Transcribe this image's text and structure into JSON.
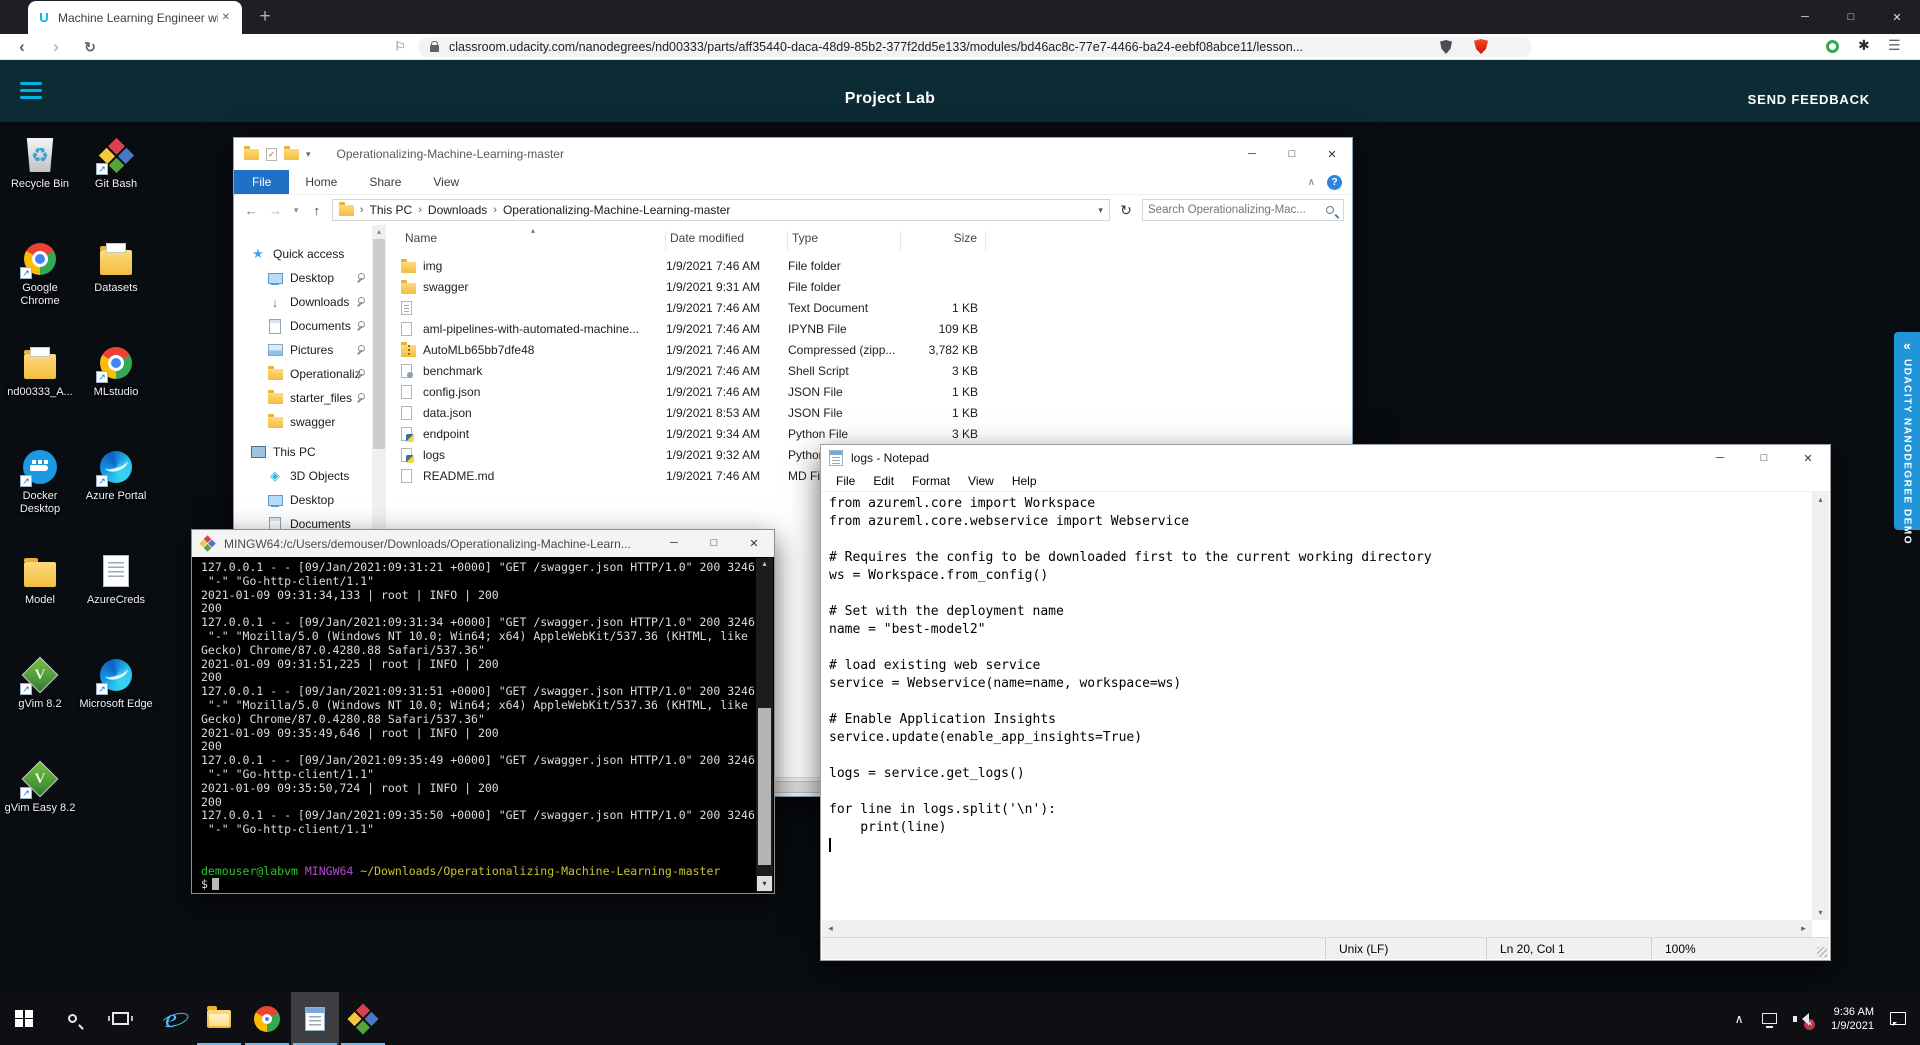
{
  "colors": {
    "accent_teal": "#02b3e3",
    "header_bg": "#0d2b35",
    "side_tab_blue": "#2095d8",
    "file_tab_blue": "#2071c5",
    "taskbar_underline": "#76b9ed"
  },
  "icons": {
    "udacity_u": "U",
    "plus": "+",
    "minimize": "─",
    "maximize": "□",
    "close": "✕",
    "back": "‹",
    "forward": "›",
    "reload": "↻",
    "bookmark_flag": "⚐",
    "menu": "☰",
    "asterisk": "✱",
    "caret_down": "▾",
    "caret_up": "▴",
    "chevron_right": "›",
    "chevron_up": "∧",
    "arrow_left": "←",
    "arrow_right": "→",
    "arrow_up": "↑",
    "question": "?",
    "check": "✓",
    "recycle": "♻",
    "star": "★",
    "download": "↓",
    "cube": "◈",
    "vim_v": "V",
    "ie_e": "e",
    "scroll_left": "◂",
    "scroll_right": "▸",
    "double_chevron_left": "«",
    "tray_up": "∧"
  },
  "browser": {
    "tab_title": "Machine Learning Engineer with",
    "url": "classroom.udacity.com/nanodegrees/nd00333/parts/aff35440-daca-48d9-85b2-377f2dd5e133/modules/bd46ac8c-77e7-4466-ba24-eebf08abce11/lesson..."
  },
  "header": {
    "title": "Project Lab",
    "feedback": "SEND FEEDBACK"
  },
  "side_tab": {
    "label": "UDACITY NANODEGREE DEMO"
  },
  "desktop": {
    "icons": [
      {
        "label": "Recycle Bin"
      },
      {
        "label": "Git Bash"
      },
      {
        "label": "Google Chrome"
      },
      {
        "label": "Datasets"
      },
      {
        "label": "nd00333_A..."
      },
      {
        "label": "MLstudio"
      },
      {
        "label": "Docker Desktop"
      },
      {
        "label": "Azure Portal"
      },
      {
        "label": "Model"
      },
      {
        "label": "AzureCreds"
      },
      {
        "label": "gVim 8.2"
      },
      {
        "label": "Microsoft Edge"
      },
      {
        "label": "gVim Easy 8.2"
      }
    ]
  },
  "explorer": {
    "title": "Operationalizing-Machine-Learning-master",
    "tabs": {
      "file": "File",
      "home": "Home",
      "share": "Share",
      "view": "View"
    },
    "breadcrumb": [
      "This PC",
      "Downloads",
      "Operationalizing-Machine-Learning-master"
    ],
    "search_placeholder": "Search Operationalizing-Mac...",
    "columns": {
      "name": "Name",
      "date": "Date modified",
      "type": "Type",
      "size": "Size"
    },
    "sidebar": [
      {
        "label": "Quick access"
      },
      {
        "label": "Desktop"
      },
      {
        "label": "Downloads"
      },
      {
        "label": "Documents"
      },
      {
        "label": "Pictures"
      },
      {
        "label": "Operationaliz"
      },
      {
        "label": "starter_files"
      },
      {
        "label": "swagger"
      },
      {
        "label": "This PC"
      },
      {
        "label": "3D Objects"
      },
      {
        "label": "Desktop"
      },
      {
        "label": "Documents"
      }
    ],
    "files": [
      {
        "name": "img",
        "date": "1/9/2021 7:46 AM",
        "type": "File folder",
        "size": ""
      },
      {
        "name": "swagger",
        "date": "1/9/2021 9:31 AM",
        "type": "File folder",
        "size": ""
      },
      {
        "name": "",
        "date": "1/9/2021 7:46 AM",
        "type": "Text Document",
        "size": "1 KB"
      },
      {
        "name": "aml-pipelines-with-automated-machine...",
        "date": "1/9/2021 7:46 AM",
        "type": "IPYNB File",
        "size": "109 KB"
      },
      {
        "name": "AutoMLb65bb7dfe48",
        "date": "1/9/2021 7:46 AM",
        "type": "Compressed (zipp...",
        "size": "3,782 KB"
      },
      {
        "name": "benchmark",
        "date": "1/9/2021 7:46 AM",
        "type": "Shell Script",
        "size": "3 KB"
      },
      {
        "name": "config.json",
        "date": "1/9/2021 7:46 AM",
        "type": "JSON File",
        "size": "1 KB"
      },
      {
        "name": "data.json",
        "date": "1/9/2021 8:53 AM",
        "type": "JSON File",
        "size": "1 KB"
      },
      {
        "name": "endpoint",
        "date": "1/9/2021 9:34 AM",
        "type": "Python File",
        "size": "3 KB"
      },
      {
        "name": "logs",
        "date": "1/9/2021 9:32 AM",
        "type": "Python File",
        "size": ""
      },
      {
        "name": "README.md",
        "date": "1/9/2021 7:46 AM",
        "type": "MD File",
        "size": ""
      }
    ]
  },
  "terminal": {
    "title": "MINGW64:/c/Users/demouser/Downloads/Operationalizing-Machine-Learn...",
    "lines": [
      "127.0.0.1 - - [09/Jan/2021:09:31:21 +0000] \"GET /swagger.json HTTP/1.0\" 200 3246",
      " \"-\" \"Go-http-client/1.1\"",
      "2021-01-09 09:31:34,133 | root | INFO | 200",
      "200",
      "127.0.0.1 - - [09/Jan/2021:09:31:34 +0000] \"GET /swagger.json HTTP/1.0\" 200 3246",
      " \"-\" \"Mozilla/5.0 (Windows NT 10.0; Win64; x64) AppleWebKit/537.36 (KHTML, like",
      "Gecko) Chrome/87.0.4280.88 Safari/537.36\"",
      "2021-01-09 09:31:51,225 | root | INFO | 200",
      "200",
      "127.0.0.1 - - [09/Jan/2021:09:31:51 +0000] \"GET /swagger.json HTTP/1.0\" 200 3246",
      " \"-\" \"Mozilla/5.0 (Windows NT 10.0; Win64; x64) AppleWebKit/537.36 (KHTML, like",
      "Gecko) Chrome/87.0.4280.88 Safari/537.36\"",
      "2021-01-09 09:35:49,646 | root | INFO | 200",
      "200",
      "127.0.0.1 - - [09/Jan/2021:09:35:49 +0000] \"GET /swagger.json HTTP/1.0\" 200 3246",
      " \"-\" \"Go-http-client/1.1\"",
      "2021-01-09 09:35:50,724 | root | INFO | 200",
      "200",
      "127.0.0.1 - - [09/Jan/2021:09:35:50 +0000] \"GET /swagger.json HTTP/1.0\" 200 3246",
      " \"-\" \"Go-http-client/1.1\"",
      "",
      ""
    ],
    "prompt": {
      "userhost": "demouser@labvm",
      "env": "MINGW64",
      "path": "~/Downloads/Operationalizing-Machine-Learning-master",
      "symbol": "$"
    }
  },
  "notepad": {
    "title": "logs - Notepad",
    "menu": [
      "File",
      "Edit",
      "Format",
      "View",
      "Help"
    ],
    "lines": [
      "from azureml.core import Workspace",
      "from azureml.core.webservice import Webservice",
      "",
      "# Requires the config to be downloaded first to the current working directory",
      "ws = Workspace.from_config()",
      "",
      "# Set with the deployment name",
      "name = \"best-model2\"",
      "",
      "# load existing web service",
      "service = Webservice(name=name, workspace=ws)",
      "",
      "# Enable Application Insights",
      "service.update(enable_app_insights=True)",
      "",
      "logs = service.get_logs()",
      "",
      "for line in logs.split('\\n'):",
      "    print(line)"
    ],
    "status": {
      "line_ending": "Unix (LF)",
      "cursor": "Ln 20, Col 1",
      "zoom": "100%"
    }
  },
  "taskbar": {
    "time": "9:36 AM",
    "date": "1/9/2021"
  }
}
